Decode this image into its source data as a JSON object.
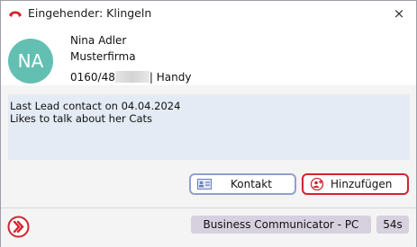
{
  "window": {
    "title": "Eingehender: Klingeln",
    "close_label": "×"
  },
  "contact": {
    "initials": "NA",
    "name": "Nina Adler",
    "company": "Musterfirma",
    "phone_prefix": "0160/48",
    "phone_type": "| Handy"
  },
  "notes": "Last Lead contact on 04.04.2024\nLikes to talk about her Cats",
  "buttons": {
    "contact_label": "Kontakt",
    "add_label": "Hinzufügen"
  },
  "footer": {
    "app_label": "Business Communicator - PC",
    "duration": "54s"
  },
  "colors": {
    "accent": "#d2232e",
    "avatar": "#64bfb3",
    "notes_bg": "#e4ebf5",
    "badge_bg": "#d6d0df"
  },
  "icons": [
    "phone-ringing-icon",
    "close-icon",
    "contact-card-icon",
    "add-contact-icon",
    "app-logo-icon"
  ]
}
